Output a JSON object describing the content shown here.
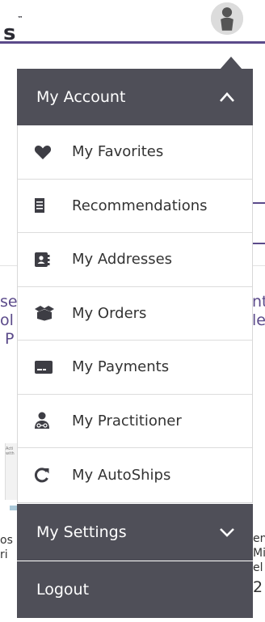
{
  "background": {
    "logo_fragment": "s",
    "logo_mark": "™",
    "left_text": [
      "se",
      "ol",
      "P"
    ],
    "right_text": [
      "nt",
      "le"
    ],
    "lower_left_text": [
      "os",
      "ri"
    ],
    "lower_right_text": [
      "en",
      "Mi",
      "el",
      "2"
    ],
    "thumb_caption": "Acti with"
  },
  "menu": {
    "account": {
      "title": "My Account",
      "toggle_icon": "chevron-up-icon",
      "items": [
        {
          "label": "My Favorites",
          "icon": "heart-icon"
        },
        {
          "label": "Recommendations",
          "icon": "document-icon"
        },
        {
          "label": "My Addresses",
          "icon": "address-book-icon"
        },
        {
          "label": "My Orders",
          "icon": "open-box-icon"
        },
        {
          "label": "My Payments",
          "icon": "credit-card-icon"
        },
        {
          "label": "My Practitioner",
          "icon": "doctor-icon"
        },
        {
          "label": "My AutoShips",
          "icon": "refresh-icon"
        }
      ]
    },
    "settings": {
      "title": "My Settings",
      "toggle_icon": "chevron-down-icon"
    },
    "logout": {
      "title": "Logout"
    }
  },
  "colors": {
    "header_bg": "#4f4f58",
    "brand_purple": "#5b4a8a"
  }
}
